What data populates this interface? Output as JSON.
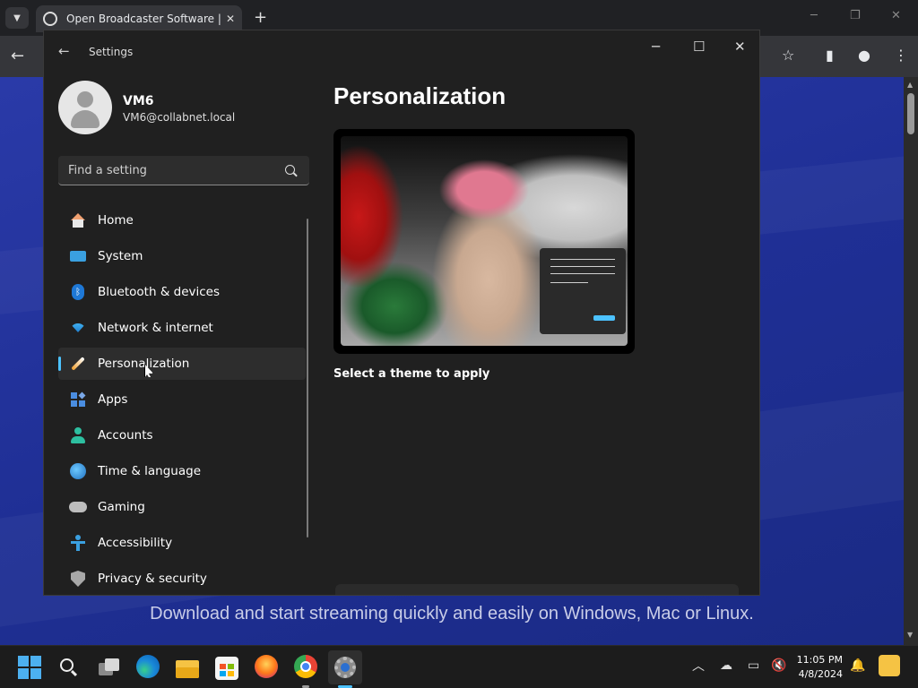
{
  "browser": {
    "tab_title": "Open Broadcaster Software | OBS",
    "tab_close": "✕",
    "new_tab": "+",
    "back": "←",
    "tagline": "Download and start streaming quickly and easily on Windows, Mac or Linux."
  },
  "settings": {
    "app_title": "Settings",
    "back": "←",
    "user": {
      "name": "VM6",
      "email": "VM6@collabnet.local"
    },
    "search": {
      "placeholder": "Find a setting"
    },
    "nav": [
      {
        "label": "Home",
        "icon": "home-icon"
      },
      {
        "label": "System",
        "icon": "system-icon"
      },
      {
        "label": "Bluetooth & devices",
        "icon": "bluetooth-icon"
      },
      {
        "label": "Network & internet",
        "icon": "wifi-icon"
      },
      {
        "label": "Personalization",
        "icon": "brush-icon",
        "selected": true
      },
      {
        "label": "Apps",
        "icon": "apps-icon"
      },
      {
        "label": "Accounts",
        "icon": "account-icon"
      },
      {
        "label": "Time & language",
        "icon": "globe-clock-icon"
      },
      {
        "label": "Gaming",
        "icon": "gamepad-icon"
      },
      {
        "label": "Accessibility",
        "icon": "accessibility-icon"
      },
      {
        "label": "Privacy & security",
        "icon": "shield-icon"
      }
    ],
    "page_title": "Personalization",
    "theme_section_label": "Select a theme to apply",
    "accent_color": "#4cc2ff"
  },
  "taskbar": {
    "time": "11:05 PM",
    "date": "4/8/2024"
  }
}
